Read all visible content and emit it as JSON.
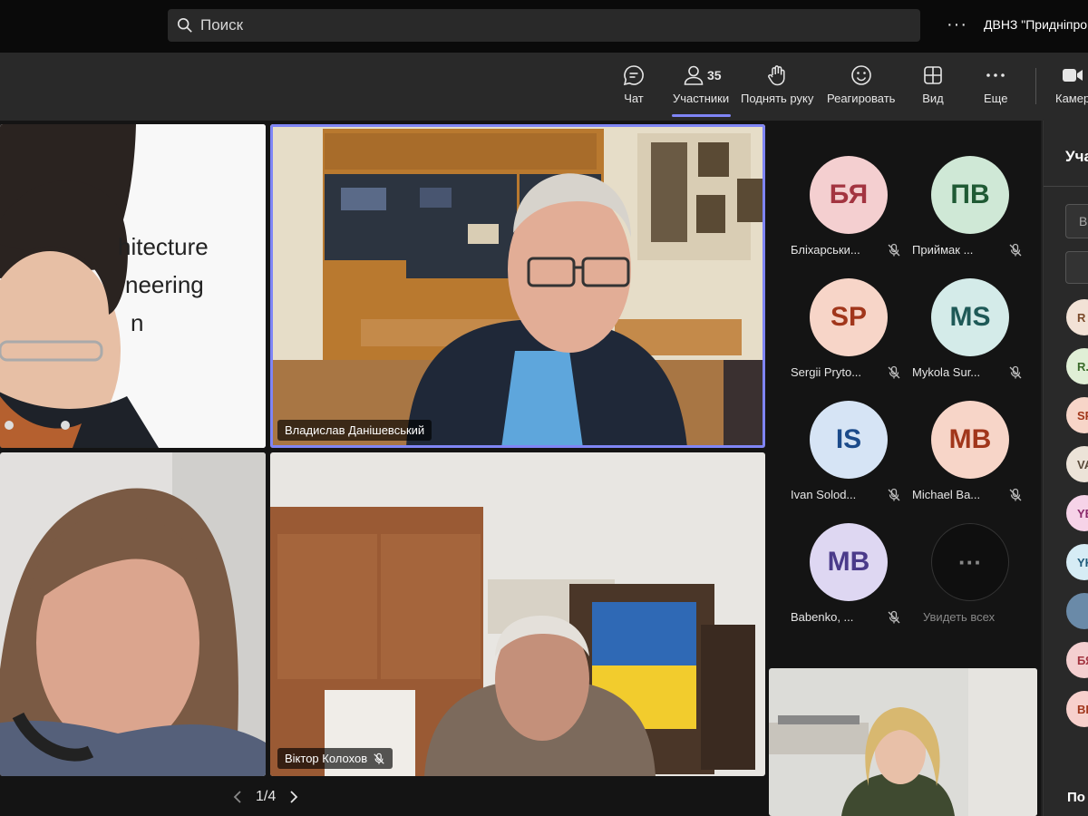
{
  "titlebar": {
    "search_placeholder": "Поиск",
    "org_name": "ДВНЗ \"Придніпро"
  },
  "toolbar": {
    "chat": "Чат",
    "participants": "Участники",
    "participants_count": "35",
    "raise_hand": "Поднять руку",
    "react": "Реагировать",
    "view": "Вид",
    "more": "Еще",
    "camera": "Камер"
  },
  "videos": {
    "tile1_slide_lines": [
      "hitecture",
      "neering",
      "n"
    ],
    "tile2_name": "Владислав Данішевський",
    "tile4_name": "Віктор Колохов"
  },
  "roster": [
    {
      "initials": "БЯ",
      "name": "Бліхарськи...",
      "bg": "#f4cfd0",
      "fg": "#a33440"
    },
    {
      "initials": "ПВ",
      "name": "Приймак ...",
      "bg": "#cfe8d6",
      "fg": "#1f5a34"
    },
    {
      "initials": "SP",
      "name": "Sergii Pryto...",
      "bg": "#f7d5c8",
      "fg": "#a1361b"
    },
    {
      "initials": "MS",
      "name": "Mykola Sur...",
      "bg": "#d4ebe9",
      "fg": "#1e5957"
    },
    {
      "initials": "IS",
      "name": "Ivan Solod...",
      "bg": "#d6e4f5",
      "fg": "#1b4a8a"
    },
    {
      "initials": "MB",
      "name": "Michael Ba...",
      "bg": "#f7d5c8",
      "fg": "#a1361b"
    },
    {
      "initials": "MB",
      "name": "Babenko, ...",
      "bg": "#ded7f2",
      "fg": "#4a3a8a"
    }
  ],
  "see_all": "Увидеть всех",
  "pager": {
    "text": "1/4"
  },
  "panel": {
    "title": "Уча",
    "search_letter": "В",
    "avatars": [
      {
        "initials": "R",
        "bg": "#f2e2d6",
        "fg": "#7a4a2a"
      },
      {
        "initials": "R.",
        "bg": "#e0efd6",
        "fg": "#3a6a2a"
      },
      {
        "initials": "SP",
        "bg": "#f7d5c8",
        "fg": "#a1361b"
      },
      {
        "initials": "VA",
        "bg": "#ece3d8",
        "fg": "#5a4a3a"
      },
      {
        "initials": "YB",
        "bg": "#f6d3e8",
        "fg": "#8a2a6a"
      },
      {
        "initials": "YK",
        "bg": "#d6ecf5",
        "fg": "#1f5a7a"
      },
      {
        "initials": "",
        "bg": "#6a8aa8",
        "fg": "#ffffff"
      },
      {
        "initials": "БЯ",
        "bg": "#f4cfd0",
        "fg": "#a33440"
      },
      {
        "initials": "ВК",
        "bg": "#f7d0cc",
        "fg": "#a1361b"
      }
    ],
    "footer": "По"
  },
  "colors": {
    "accent": "#7f85f5",
    "toolbar": "#292929",
    "titlebar": "#0a0a0a"
  }
}
